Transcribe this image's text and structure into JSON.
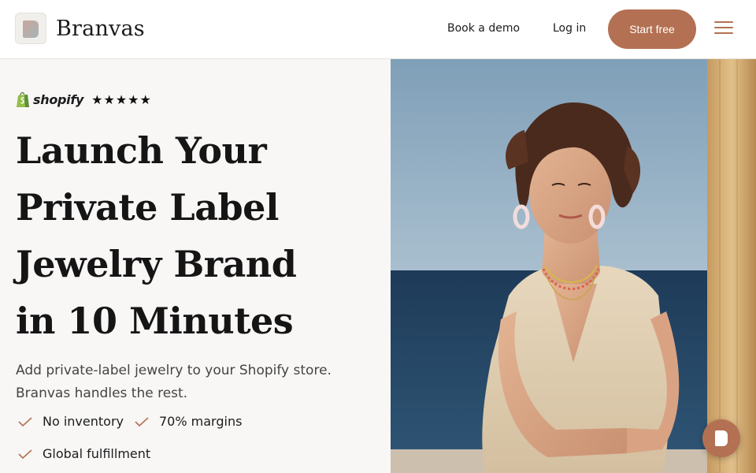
{
  "header": {
    "brand": "Branvas",
    "nav": {
      "demo": "Book a demo",
      "login": "Log in"
    },
    "cta": "Start free",
    "menu_icon": "hamburger-menu-icon"
  },
  "hero": {
    "badge": {
      "platform": "shopify",
      "rating_stars": "★★★★★",
      "rating": 5
    },
    "headline": [
      "Launch Your",
      "Private Label",
      "Jewelry Brand",
      "in 10 Minutes"
    ],
    "subtext": [
      "Add private-label jewelry to your Shopify store.",
      "Branvas handles the rest."
    ],
    "features": [
      "No inventory",
      "70% margins",
      "Global fulfillment"
    ]
  },
  "colors": {
    "accent": "#b47052",
    "hero_bg": "#f9f7f6",
    "sea": "#1f3d5c",
    "sky": "#8aa6bd"
  },
  "chat": {
    "icon": "branvas-chat-icon"
  }
}
